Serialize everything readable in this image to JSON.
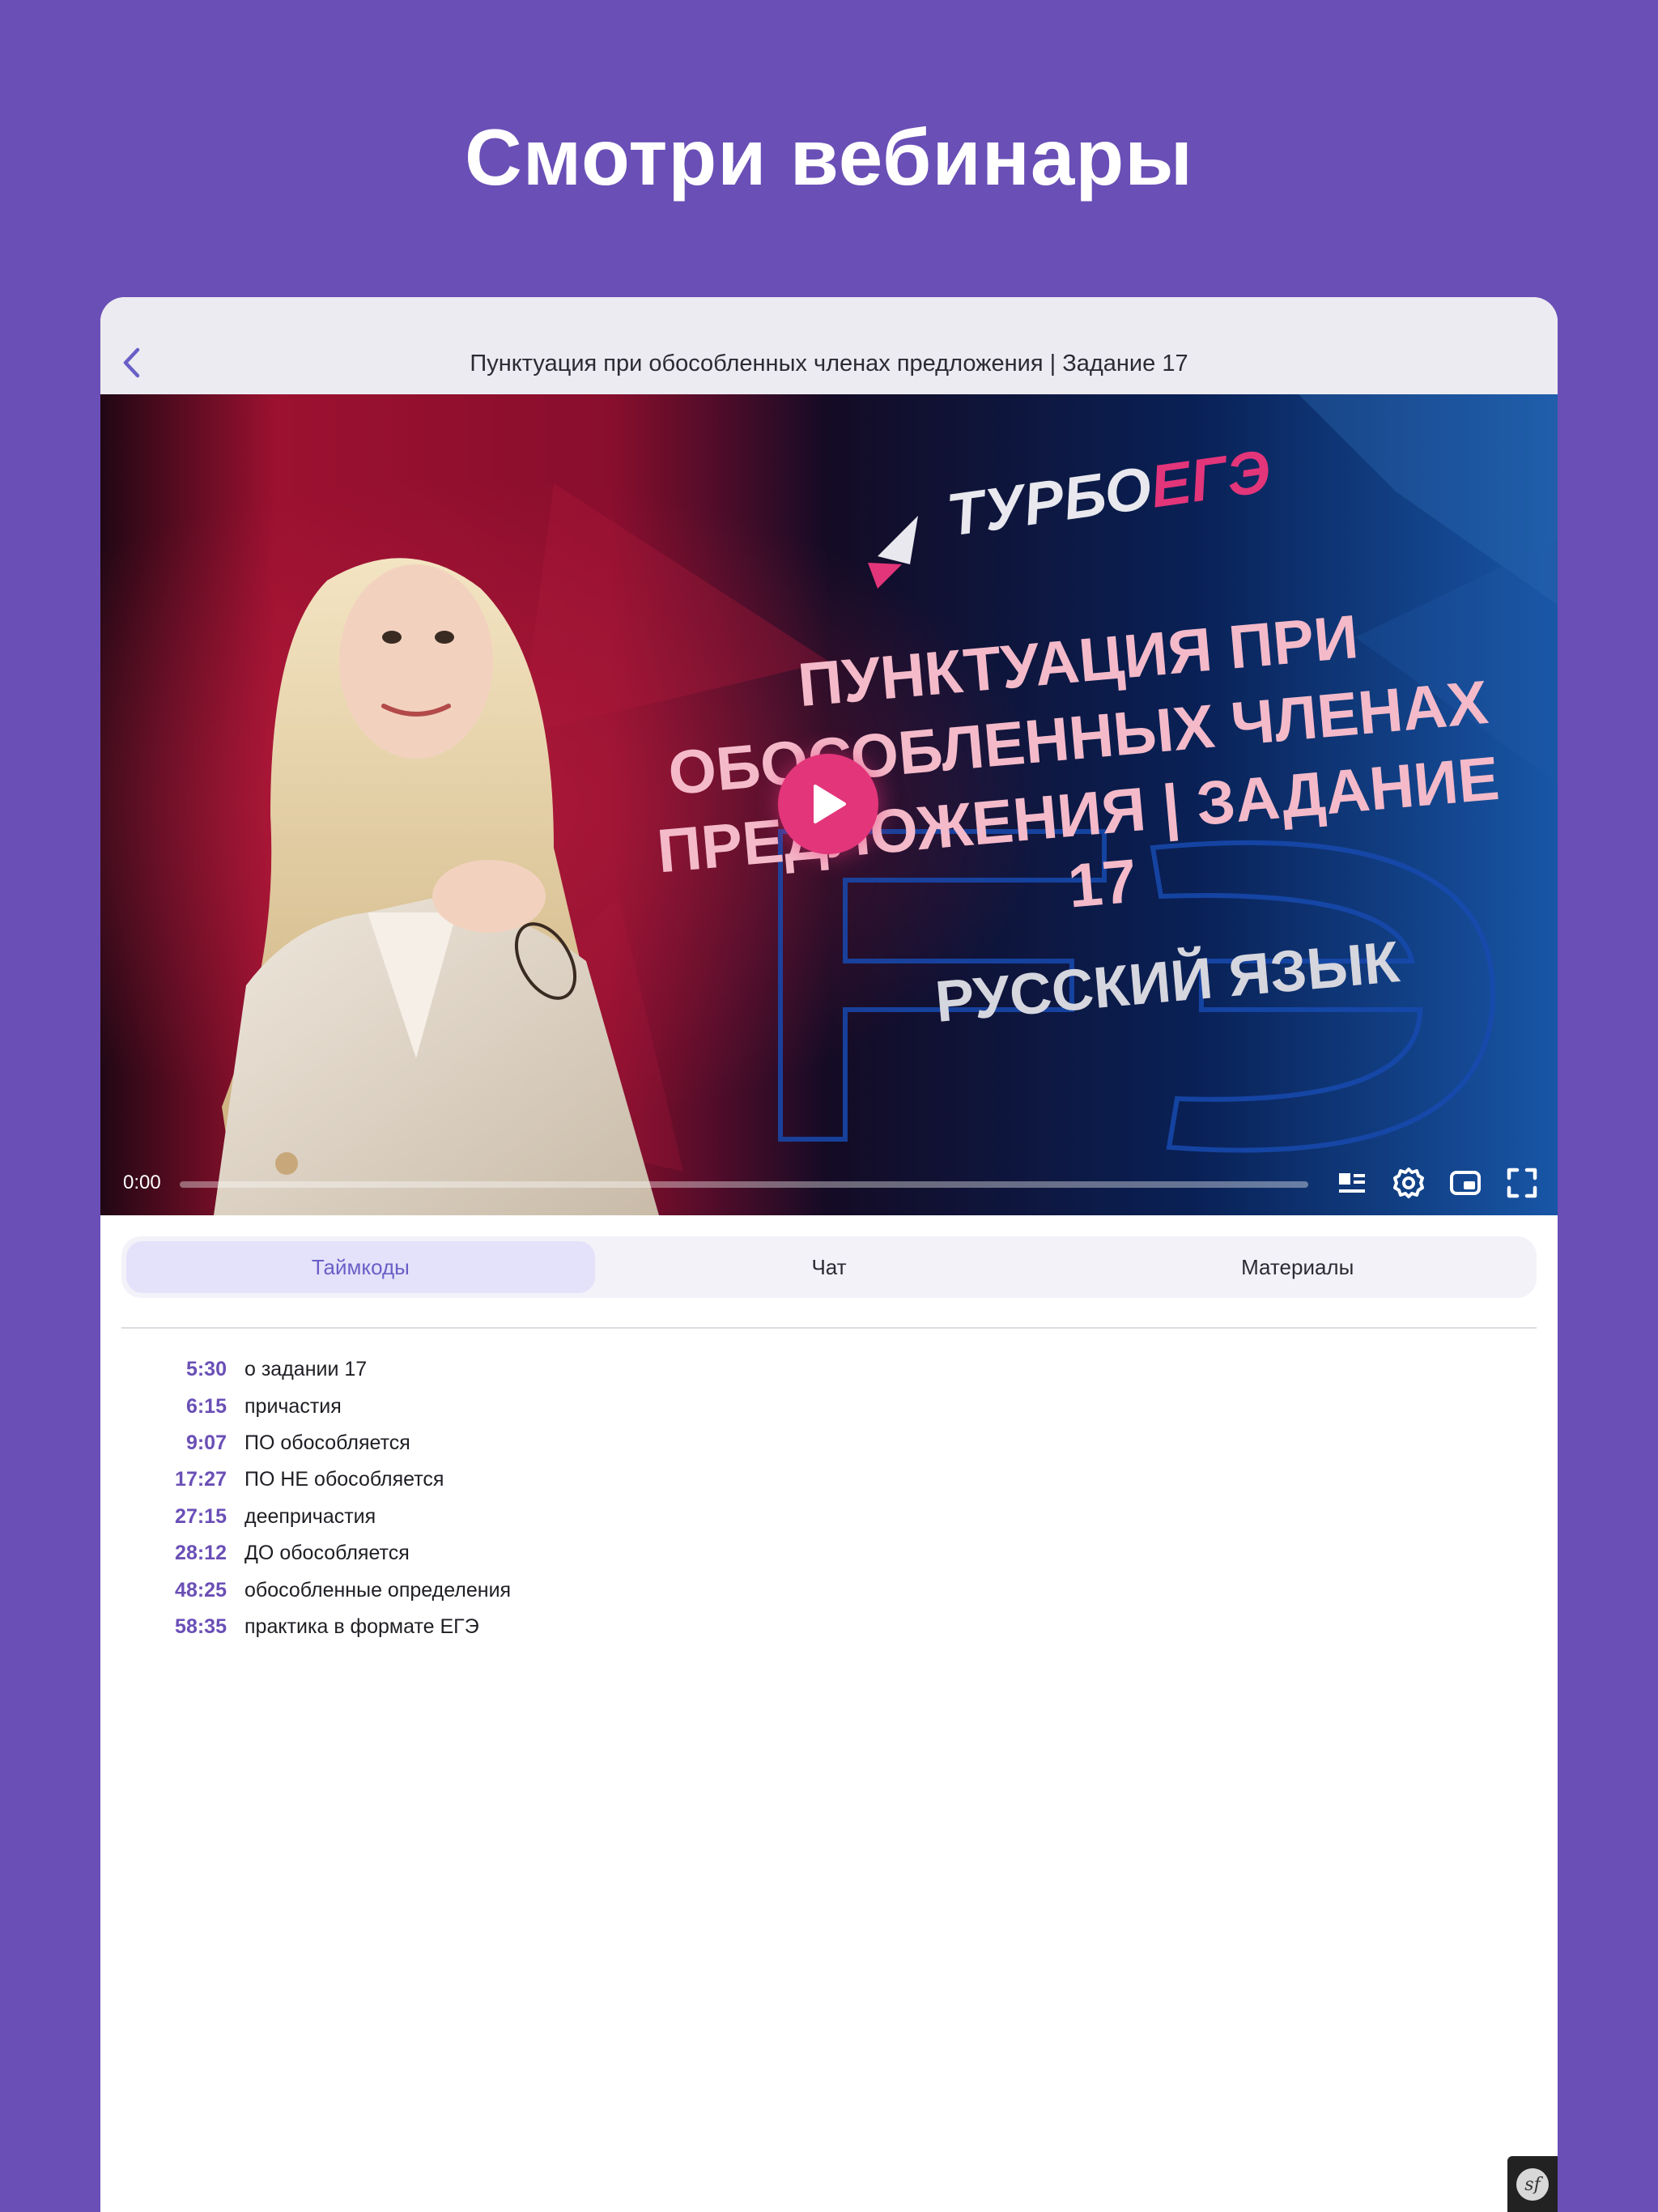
{
  "headline": "Смотри вебинары",
  "navbar": {
    "back_icon": "chevron-left-icon",
    "title": "Пунктуация при обособленных членах предложения | Задание 17"
  },
  "video": {
    "poster_text": {
      "brand_part1": "ТУРБО",
      "brand_part2": "ЕГЭ",
      "headline_lines": [
        "ПУНКТУАЦИЯ ПРИ",
        "ОБОСОБЛЕННЫХ ЧЛЕНАХ",
        "ПРЕДЛОЖЕНИЯ | ЗАДАНИЕ",
        "17"
      ],
      "subject": "РУССКИЙ ЯЗЫК",
      "backdrop": "ЕГЭ"
    },
    "current_time": "0:00",
    "progress_fraction": 0.0,
    "controls": [
      "chapters-icon",
      "settings-icon",
      "picture-in-picture-icon",
      "fullscreen-icon"
    ],
    "play_icon": "play-icon"
  },
  "tabs": [
    {
      "label": "Таймкоды",
      "active": true
    },
    {
      "label": "Чат",
      "active": false
    },
    {
      "label": "Материалы",
      "active": false
    }
  ],
  "timecodes": [
    {
      "time": "5:30",
      "label": "о задании 17"
    },
    {
      "time": "6:15",
      "label": "причастия"
    },
    {
      "time": "9:07",
      "label": "ПО обособляется"
    },
    {
      "time": "17:27",
      "label": "ПО НЕ обособляется"
    },
    {
      "time": "27:15",
      "label": "деепричастия"
    },
    {
      "time": "28:12",
      "label": "ДО обособляется"
    },
    {
      "time": "48:25",
      "label": "обособленные определения"
    },
    {
      "time": "58:35",
      "label": "практика в формате ЕГЭ"
    }
  ],
  "colors": {
    "background": "#6a4fb6",
    "accent": "#6a4fb6",
    "play": "#e3357a",
    "active_tab_bg": "#e4e1fb"
  }
}
